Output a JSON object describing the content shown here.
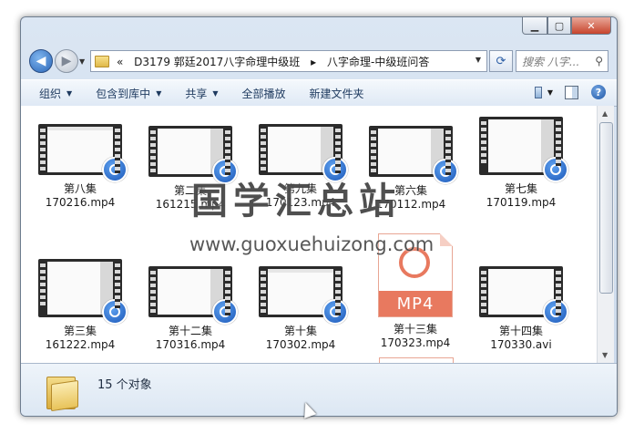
{
  "window": {
    "controls": {
      "minimize": "▁",
      "maximize": "▢",
      "close": "✕"
    }
  },
  "address": {
    "overflow": "«",
    "crumbs": [
      "D3179 郭廷2017八字命理中级班",
      "八字命理-中级班问答"
    ],
    "separator": "▸"
  },
  "search": {
    "placeholder": "搜索 八字..."
  },
  "toolbar": {
    "organize": "组织",
    "include_library": "包含到库中",
    "share": "共享",
    "play_all": "全部播放",
    "new_folder": "新建文件夹"
  },
  "files": [
    {
      "name": "第八集",
      "file": "170216.mp4",
      "type": "video"
    },
    {
      "name": "第二集",
      "file": "161215.mp4",
      "type": "video"
    },
    {
      "name": "第九集",
      "file": "170123.mp4",
      "type": "video"
    },
    {
      "name": "第六集",
      "file": "170112.mp4",
      "type": "video"
    },
    {
      "name": "第七集",
      "file": "170119.mp4",
      "type": "video"
    },
    {
      "name": "第三集",
      "file": "161222.mp4",
      "type": "video"
    },
    {
      "name": "第十二集",
      "file": "170316.mp4",
      "type": "video"
    },
    {
      "name": "第十集",
      "file": "170302.mp4",
      "type": "video"
    },
    {
      "name": "第十三集",
      "file": "170323.mp4",
      "type": "mp4doc",
      "badge": "MP4"
    },
    {
      "name": "第十四集",
      "file": "170330.avi",
      "type": "video"
    }
  ],
  "status": {
    "count_text": "15 个对象"
  },
  "watermark": {
    "title": "国学汇总站",
    "url": "www.guoxuehuizong.com"
  },
  "colors": {
    "accent": "#2a66b8",
    "mp4": "#e8795f"
  }
}
